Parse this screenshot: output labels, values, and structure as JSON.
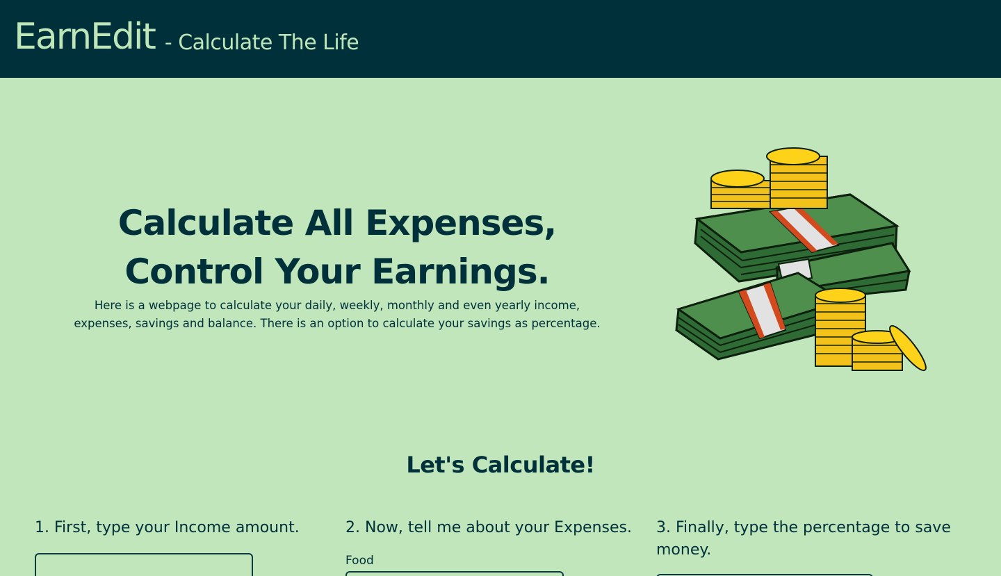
{
  "header": {
    "brand": "EarnEdit",
    "tagline": "- Calculate The Life"
  },
  "hero": {
    "title_line1": "Calculate All Expenses,",
    "title_line2": "Control Your Earnings.",
    "description_line1": "Here is a webpage to calculate your daily, weekly, monthly and even yearly income,",
    "description_line2": "expenses, savings and balance. There is an option to calculate your savings as percentage.",
    "illustration": "money-stacks-and-coins-illustration"
  },
  "calculator": {
    "title": "Let's Calculate!",
    "step1": {
      "label": "1. First, type your Income amount.",
      "input_value": ""
    },
    "step2": {
      "label": "2. Now, tell me about your Expenses.",
      "food_label": "Food",
      "food_value": ""
    },
    "step3": {
      "label": "3. Finally, type the percentage to save money.",
      "input_value": ""
    }
  },
  "colors": {
    "header_bg": "#00313a",
    "page_bg": "#c1e6bb",
    "brand_text": "#bfe6b8",
    "body_text": "#00303a"
  }
}
